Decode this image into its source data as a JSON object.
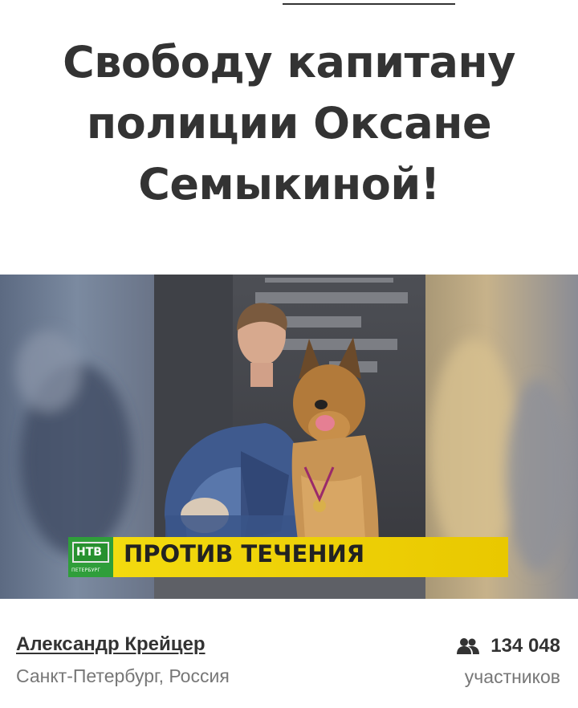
{
  "petition": {
    "title": "Свободу капитану полиции Оксане Семыкиной!"
  },
  "media": {
    "image_description_icon": "petition-photo",
    "banner": {
      "text": "ПРОТИВ ТЕЧЕНИЯ",
      "logo_text": "НТВ",
      "logo_subtext": "ПЕТЕРБУРГ"
    },
    "colors": {
      "banner_yellow": "#f2d600",
      "logo_green": "#2f9e3a"
    }
  },
  "author": {
    "name": "Александр Крейцер",
    "location": "Санкт-Петербург, Россия"
  },
  "supporters": {
    "count": "134 048",
    "label": "участников",
    "icon": "people-icon"
  }
}
